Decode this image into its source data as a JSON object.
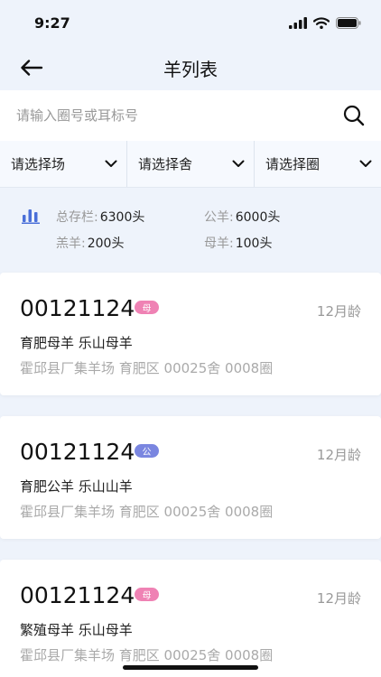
{
  "status_bar": {
    "time": "9:27"
  },
  "nav": {
    "title": "羊列表"
  },
  "search": {
    "placeholder": "请输入圈号或耳标号"
  },
  "filters": [
    "请选择场",
    "请选择舍",
    "请选择圈"
  ],
  "stats": {
    "total_label": "总存栏:",
    "total_value": "6300头",
    "male_label": "公羊:",
    "male_value": "6000头",
    "young_label": "羔羊:",
    "young_value": "200头",
    "female_label": "母羊:",
    "female_value": "100头"
  },
  "cards": [
    {
      "id": "00121124",
      "badge": "母",
      "age": "12月龄",
      "breed": "育肥母羊 乐山母羊",
      "location": "霍邱县厂集羊场 育肥区 00025舍 0008圈"
    },
    {
      "id": "00121124",
      "badge": "公",
      "age": "12月龄",
      "breed": "育肥公羊 乐山山羊",
      "location": "霍邱县厂集羊场 育肥区 00025舍 0008圈"
    },
    {
      "id": "00121124",
      "badge": "母",
      "age": "12月龄",
      "breed": "繁殖母羊 乐山母羊",
      "location": "霍邱县厂集羊场 育肥区 00025舍 0008圈"
    }
  ],
  "colors": {
    "female_badge": "#ef82b4",
    "male_badge": "#7a86e0",
    "accent": "#4a6fd8"
  },
  "icons": [
    "signal-icon",
    "wifi-icon",
    "battery-icon",
    "back-arrow-icon",
    "search-icon",
    "chevron-down-icon",
    "bar-chart-icon"
  ]
}
